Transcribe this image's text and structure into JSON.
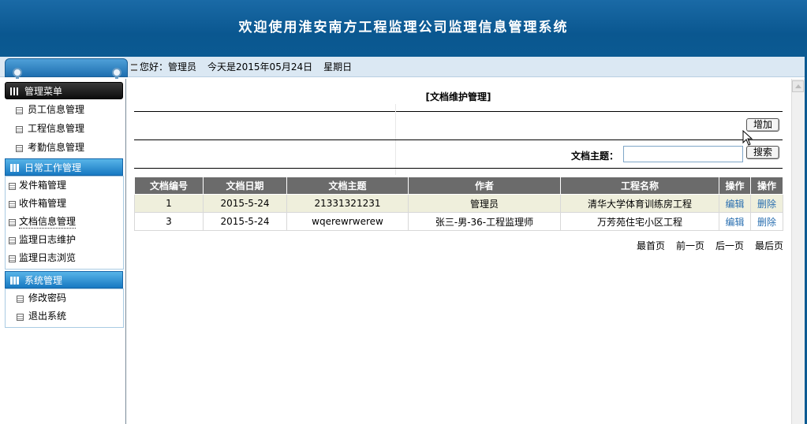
{
  "header": {
    "title": "欢迎使用淮安南方工程监理公司监理信息管理系统"
  },
  "greeting": {
    "hello": "您好：管理员",
    "today": "今天是2015年05月24日",
    "weekday": "星期日"
  },
  "sidebar": {
    "main_title": "管理菜单",
    "main_items": [
      "员工信息管理",
      "工程信息管理",
      "考勤信息管理"
    ],
    "daily_title": "日常工作管理",
    "daily_items": [
      "发件箱管理",
      "收件箱管理",
      "文档信息管理",
      "监理日志维护",
      "监理日志浏览"
    ],
    "system_title": "系统管理",
    "system_items": [
      "修改密码",
      "退出系统"
    ]
  },
  "main": {
    "title": "[文档维护管理]",
    "add_button": "增加",
    "search_label": "文档主题：",
    "search_value": "",
    "search_button": "搜索"
  },
  "table": {
    "headers": [
      "文档编号",
      "文档日期",
      "文档主题",
      "作者",
      "工程名称",
      "操作",
      "操作"
    ],
    "rows": [
      [
        "1",
        "2015-5-24",
        "21331321231",
        "管理员",
        "清华大学体育训练房工程",
        "编辑",
        "删除"
      ],
      [
        "3",
        "2015-5-24",
        "wqerewrwerew",
        "张三-男-36-工程监理师",
        "万芳苑住宅小区工程",
        "编辑",
        "删除"
      ]
    ]
  },
  "pager": {
    "first": "最首页",
    "prev": "前一页",
    "next": "后一页",
    "last": "最后页"
  },
  "colors": {
    "banner": "#0b5a92",
    "accent_blue": "#1779c2",
    "table_header": "#6b6b6b",
    "row_highlight": "#efefdc",
    "link": "#2a6fb0"
  }
}
